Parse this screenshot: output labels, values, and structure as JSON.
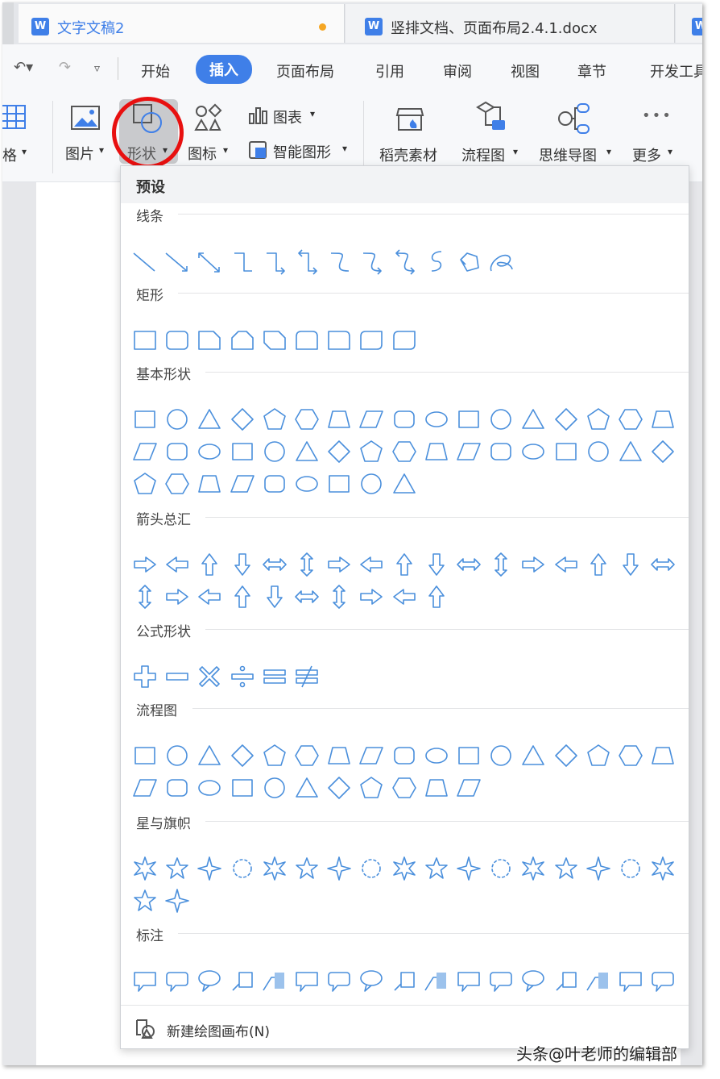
{
  "tabs": [
    {
      "label": "文字文稿2",
      "unsaved": true,
      "active": true
    },
    {
      "label": "竖排文档、页面布局2.4.1.docx",
      "unsaved": false,
      "active": false
    }
  ],
  "doc_icon_letter": "W",
  "menu": {
    "quick_access": [
      "undo-icon",
      "redo-icon",
      "customize-icon"
    ],
    "items": [
      {
        "label": "开始",
        "active": false
      },
      {
        "label": "插入",
        "active": true
      },
      {
        "label": "页面布局",
        "active": false
      },
      {
        "label": "引用",
        "active": false
      },
      {
        "label": "审阅",
        "active": false
      },
      {
        "label": "视图",
        "active": false
      },
      {
        "label": "章节",
        "active": false
      },
      {
        "label": "开发工具",
        "active": false
      }
    ]
  },
  "ribbon": {
    "table_partial": "格",
    "picture": "图片",
    "shape": "形状",
    "icon": "图标",
    "chart": "图表",
    "smart_graphic": "智能图形",
    "daoke": "稻壳素材",
    "flowchart": "流程图",
    "mindmap": "思维导图",
    "more": "更多"
  },
  "dropdown": {
    "header": "预设",
    "sections": [
      {
        "title": "线条",
        "count": 12
      },
      {
        "title": "矩形",
        "count": 9
      },
      {
        "title": "基本形状",
        "count": 43
      },
      {
        "title": "箭头总汇",
        "count": 27
      },
      {
        "title": "公式形状",
        "count": 6
      },
      {
        "title": "流程图",
        "count": 28
      },
      {
        "title": "星与旗帜",
        "count": 19
      },
      {
        "title": "标注",
        "count": 17
      }
    ],
    "footer": "新建绘图画布(N)"
  },
  "watermark": "头条@叶老师的编辑部",
  "colors": {
    "accent": "#3f7fe8",
    "shape_stroke": "#4a8fdc",
    "highlight_circle": "#e81010",
    "unsaved_dot": "#f5a623"
  }
}
